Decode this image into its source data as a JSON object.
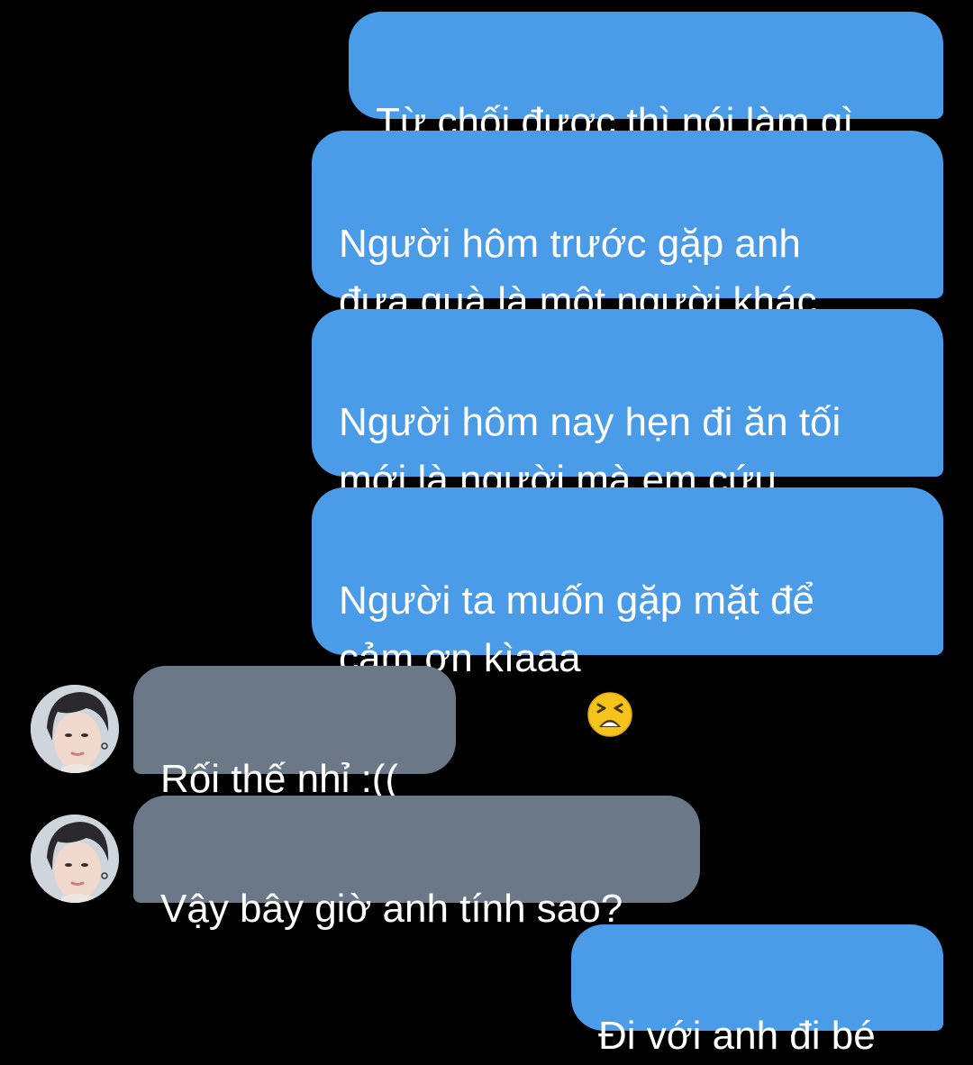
{
  "messages": [
    {
      "side": "sent",
      "text": "Từ chối được thì nói làm gì"
    },
    {
      "side": "sent",
      "text": "Người hôm trước gặp anh\nđưa quà là một người khác"
    },
    {
      "side": "sent",
      "text": "Người hôm nay hẹn đi ăn tối\nmới là người mà em cứu"
    },
    {
      "side": "sent",
      "text": "Người ta muốn gặp mặt để\ncảm ơn kìaaa",
      "emoji": "tired-face-emoji"
    },
    {
      "side": "received",
      "text": "Rối thế nhỉ :(("
    },
    {
      "side": "received",
      "text": "Vậy bây giờ anh tính sao?"
    },
    {
      "side": "sent",
      "text": "Đi với anh đi bé"
    }
  ],
  "colors": {
    "background": "#000000",
    "sent_bubble": "#4a9be8",
    "received_bubble": "#6b7888",
    "text": "#ffffff"
  },
  "icons": {
    "avatar": "contact-avatar-photo",
    "emoji": "tired-face-emoji"
  }
}
